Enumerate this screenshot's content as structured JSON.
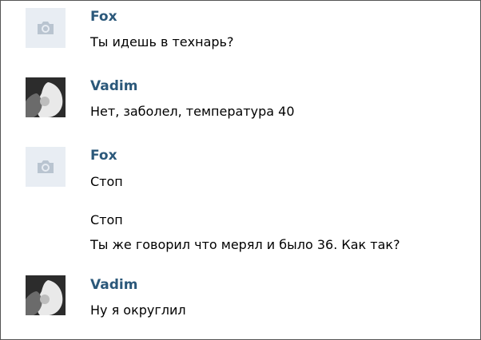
{
  "messages": [
    {
      "author": "Fox",
      "avatar": "camera-placeholder-icon",
      "lines": [
        "Ты идешь в технарь?"
      ]
    },
    {
      "author": "Vadim",
      "avatar": "user-photo",
      "lines": [
        "Нет, заболел, температура 40"
      ]
    },
    {
      "author": "Fox",
      "avatar": "camera-placeholder-icon",
      "lines": [
        "Стоп",
        "Стоп",
        "Ты же говорил что мерял и было 36. Как так?"
      ]
    },
    {
      "author": "Vadim",
      "avatar": "user-photo",
      "lines": [
        "Ну я округлил"
      ]
    }
  ],
  "colors": {
    "author": "#2b587a",
    "text": "#000000",
    "placeholder_bg": "#e8edf3",
    "camera": "#b9c4d0"
  }
}
